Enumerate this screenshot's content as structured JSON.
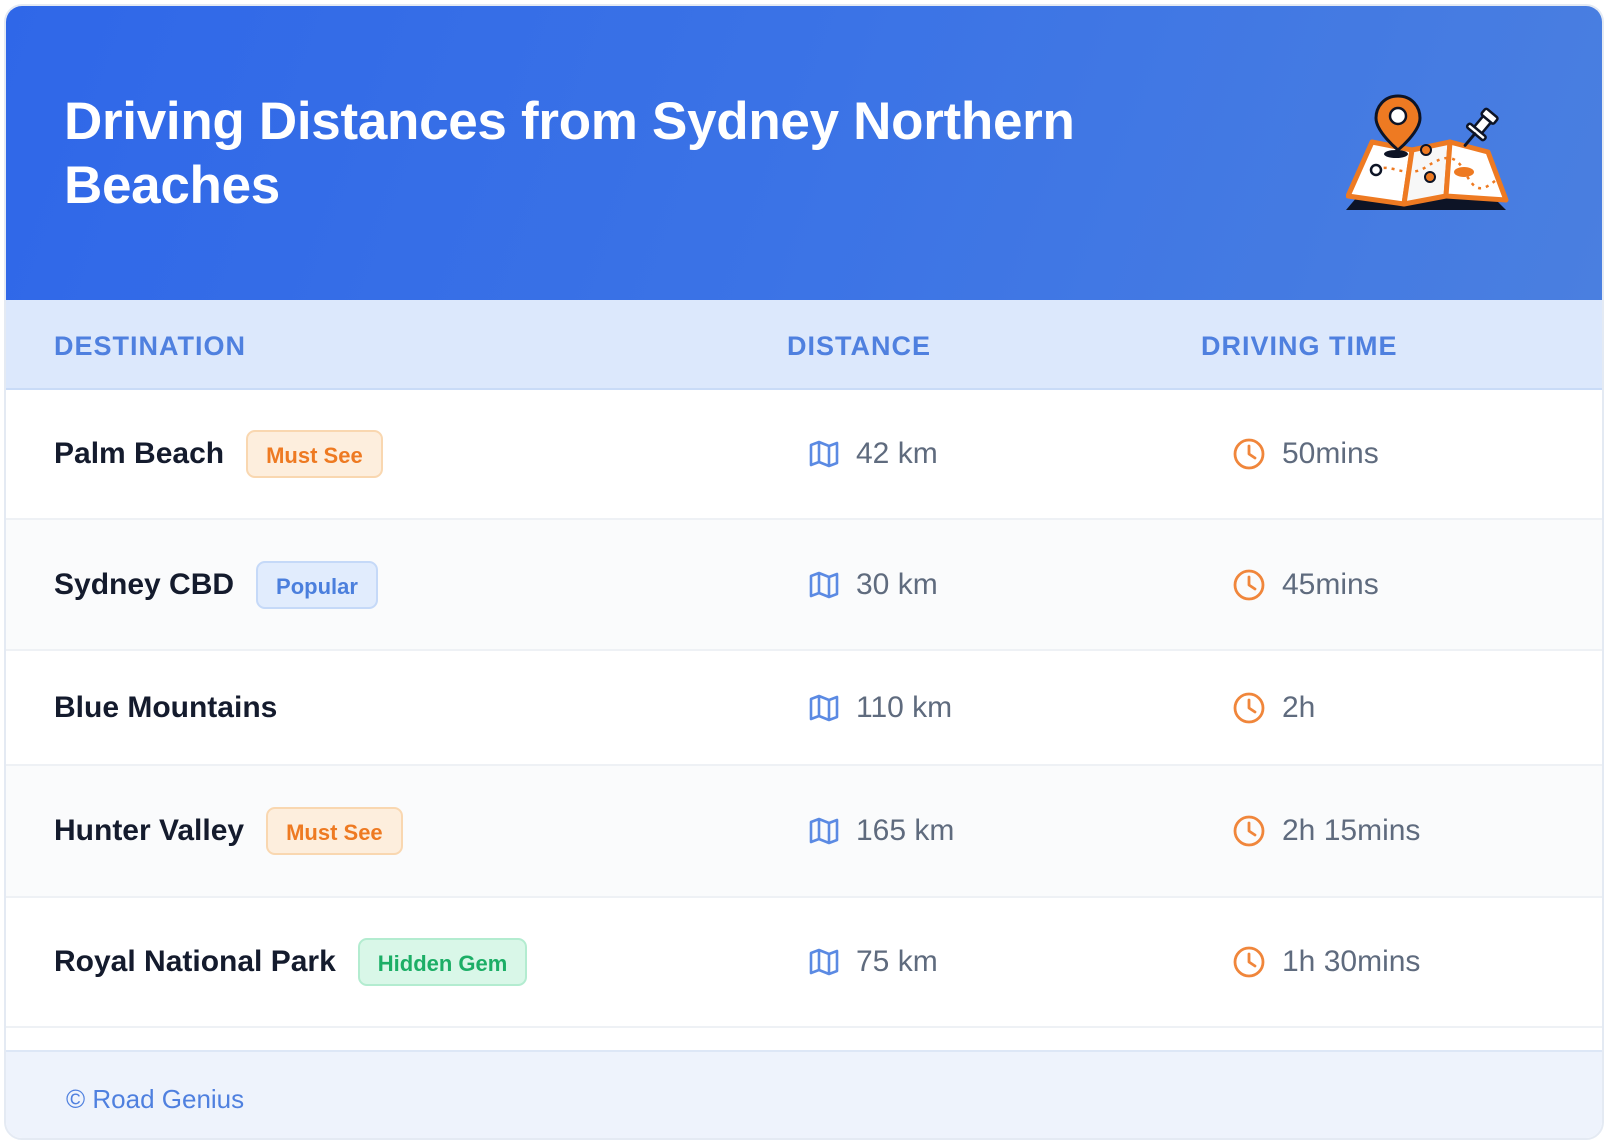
{
  "header": {
    "title": "Driving Distances from Sydney Northern Beaches",
    "illustration_icon": "folded-map-with-location-pin-icon"
  },
  "table": {
    "columns": [
      "DESTINATION",
      "DISTANCE",
      "DRIVING TIME"
    ],
    "distance_icon": "map-icon",
    "time_icon": "clock-icon",
    "rows": [
      {
        "destination": "Palm Beach",
        "badge": "Must See",
        "badge_color": "#ee7a22",
        "distance": "42 km",
        "time": "50mins"
      },
      {
        "destination": "Sydney CBD",
        "badge": "Popular",
        "badge_color": "#4b7fdd",
        "distance": "30 km",
        "time": "45mins"
      },
      {
        "destination": "Blue Mountains",
        "badge": null,
        "badge_color": null,
        "distance": "110 km",
        "time": "2h"
      },
      {
        "destination": "Hunter Valley",
        "badge": "Must See",
        "badge_color": "#ee7a22",
        "distance": "165 km",
        "time": "2h 15mins"
      },
      {
        "destination": "Royal National Park",
        "badge": "Hidden Gem",
        "badge_color": "#1cae66",
        "distance": "75 km",
        "time": "1h 30mins"
      }
    ]
  },
  "footer": {
    "text": "© Road Genius"
  },
  "colors": {
    "header_gradient_start": "#2f67e8",
    "header_gradient_end": "#4a7fe0",
    "column_header_text": "#4f80df",
    "distance_icon": "#5b8ae3",
    "time_icon": "#f0863b"
  }
}
